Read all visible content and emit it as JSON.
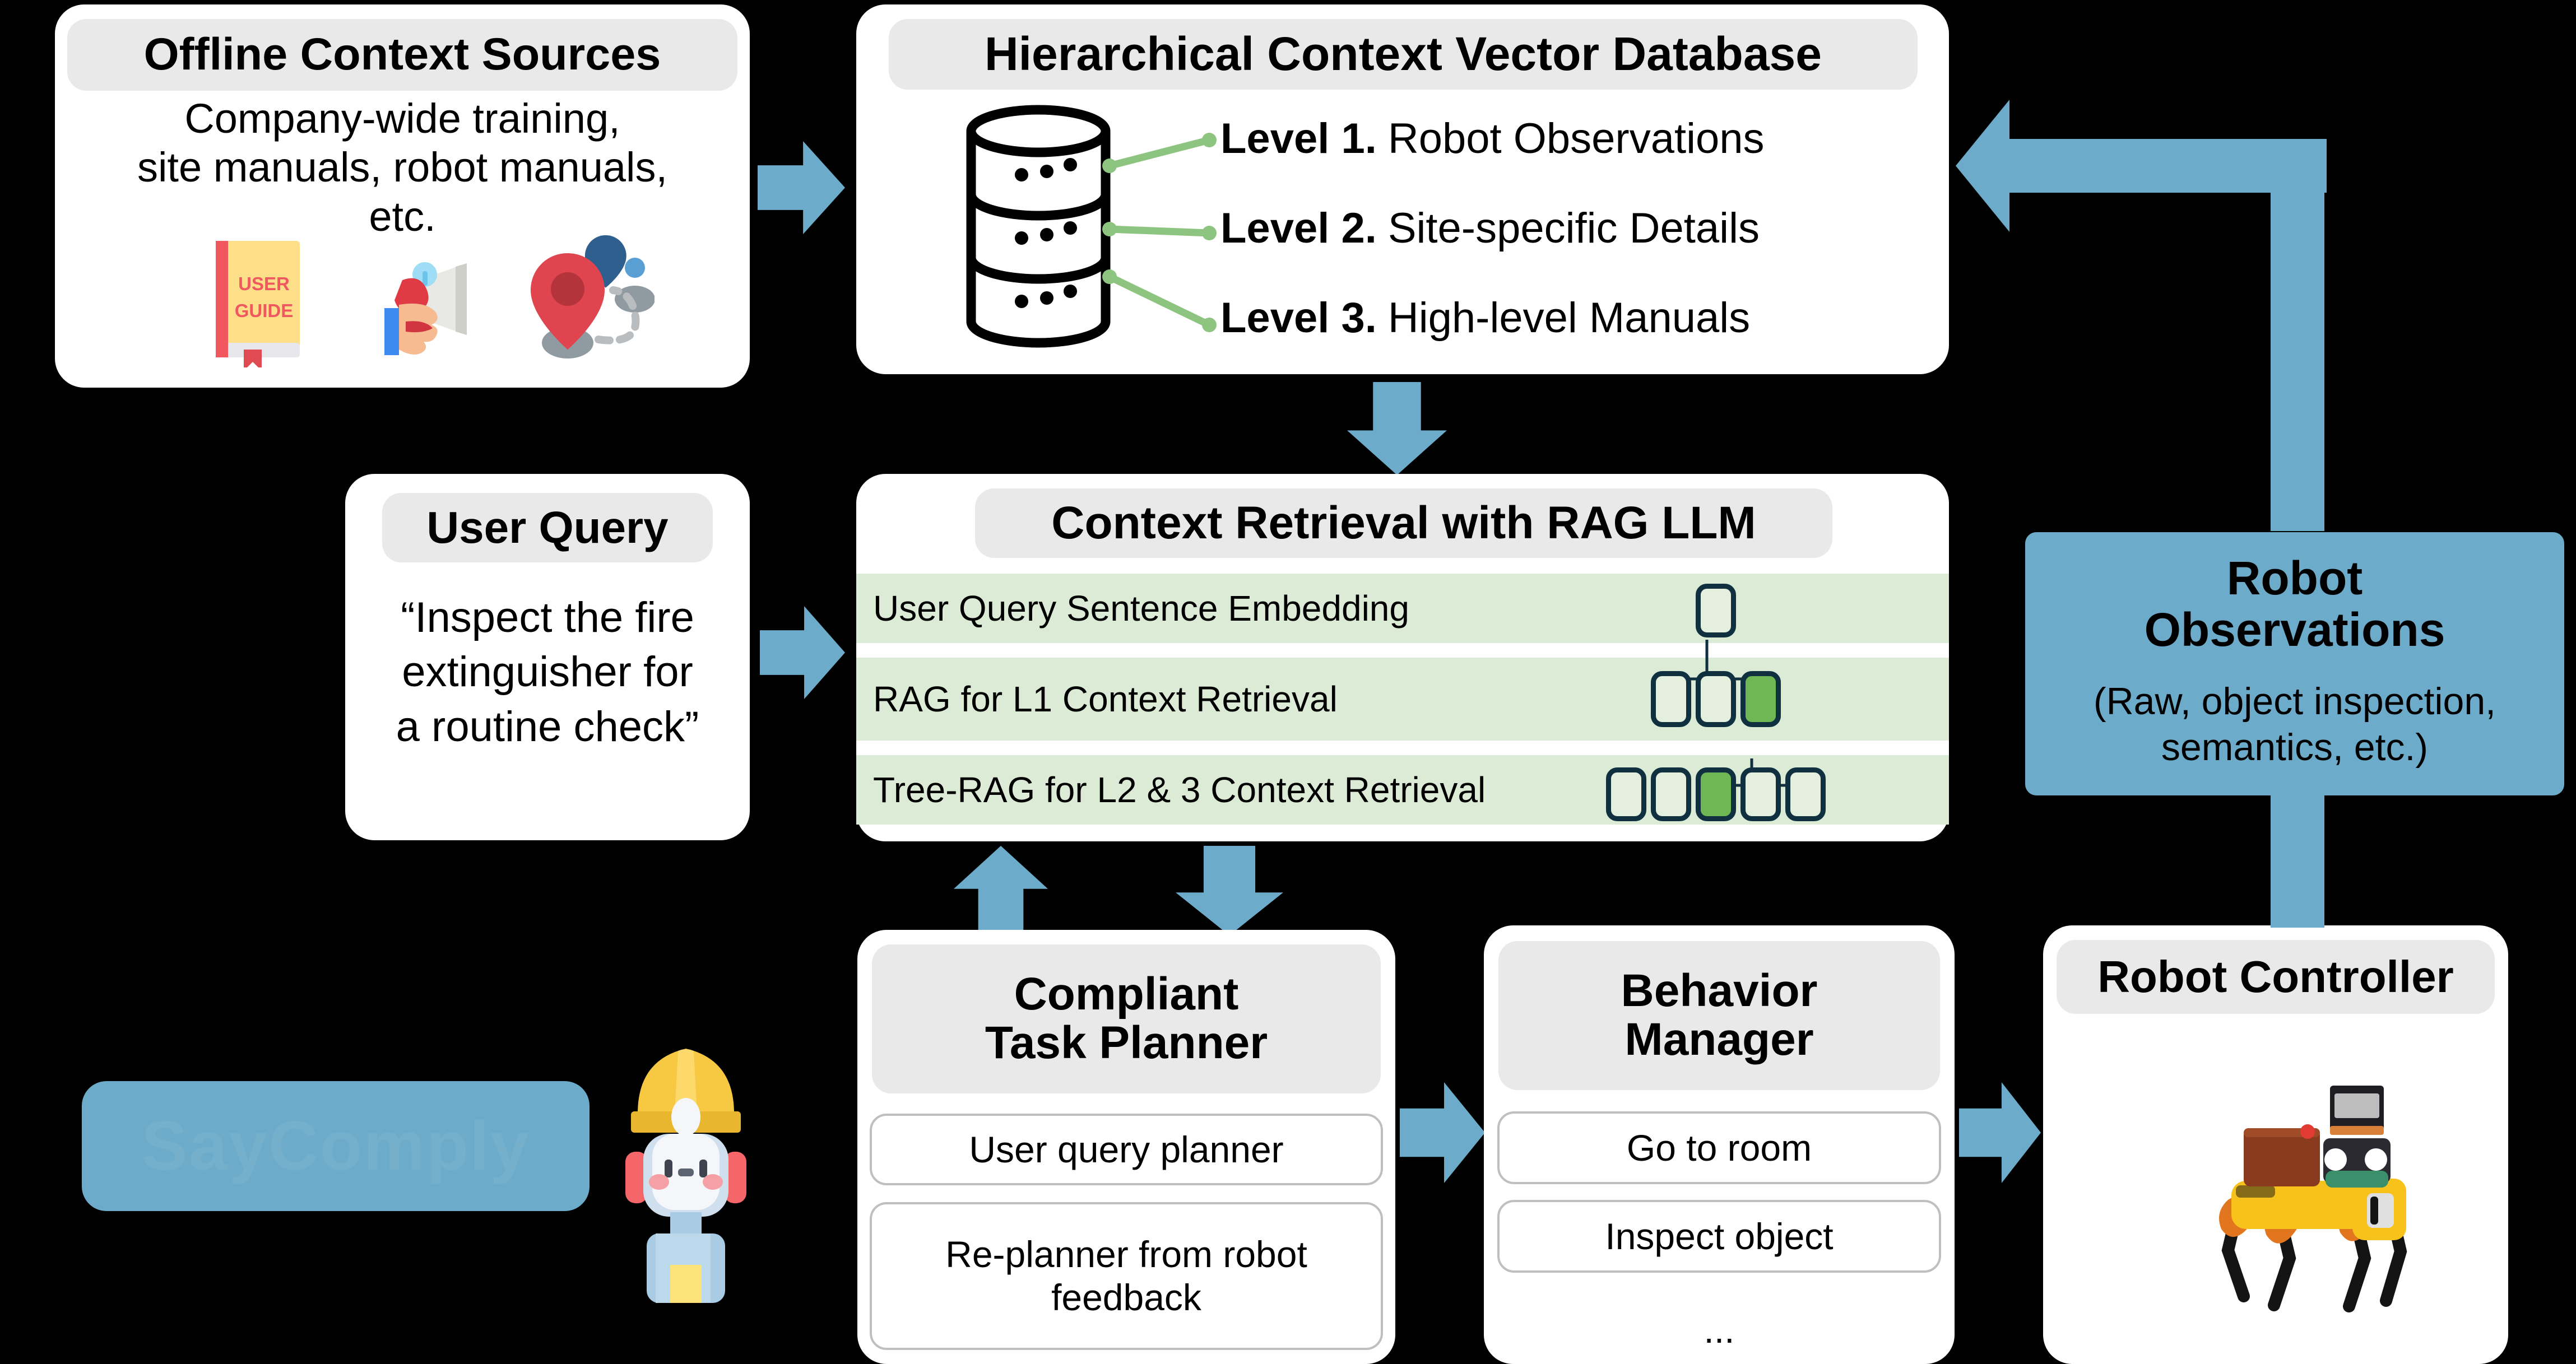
{
  "colors": {
    "arrow_blue": "#6cabc9",
    "panel_title_grey": "#e9e9e9",
    "row_green": "#dcebd5",
    "node_green": "#6fb754",
    "node_border": "#11303f",
    "leader_green": "#8dc47f",
    "background": "#000000"
  },
  "offline_sources": {
    "title": "Offline Context Sources",
    "body_line1": "Company-wide training,",
    "body_line2": "site manuals, robot manuals,",
    "body_line3": "etc.",
    "icons": [
      "user-guide-book-icon",
      "megaphone-announcement-icon",
      "map-route-pins-icon"
    ],
    "book_label_line1": "USER",
    "book_label_line2": "GUIDE"
  },
  "vector_db": {
    "title": "Hierarchical Context Vector Database",
    "icon": "database-cylinder-icon",
    "levels": [
      {
        "label": "Level 1.",
        "text": "Robot Observations"
      },
      {
        "label": "Level 2.",
        "text": "Site-specific Details"
      },
      {
        "label": "Level 3.",
        "text": "High-level Manuals"
      }
    ]
  },
  "user_query": {
    "title": "User Query",
    "line1": "“Inspect the fire",
    "line2": "extinguisher for",
    "line3": "a routine check”"
  },
  "context_retrieval": {
    "title": "Context Retrieval with RAG LLM",
    "rows": [
      {
        "label": "User Query Sentence Embedding",
        "nodes": 1,
        "highlight": -1
      },
      {
        "label": "RAG for L1 Context Retrieval",
        "nodes": 3,
        "highlight": 2
      },
      {
        "label": "Tree-RAG for L2 & 3 Context Retrieval",
        "nodes": 5,
        "highlight": 2
      }
    ]
  },
  "task_planner": {
    "title_line1": "Compliant",
    "title_line2": "Task Planner",
    "items": [
      {
        "text": "User query planner"
      },
      {
        "text": "Re-planner from robot feedback"
      }
    ]
  },
  "behavior_manager": {
    "title_line1": "Behavior",
    "title_line2": "Manager",
    "items": [
      {
        "text": "Go to room"
      },
      {
        "text": "Inspect object"
      }
    ],
    "ellipsis": "..."
  },
  "robot_controller": {
    "title": "Robot Controller",
    "icon": "quadruped-robot-icon"
  },
  "robot_observations": {
    "title_line1": "Robot",
    "title_line2": "Observations",
    "sub_line1": "(Raw, object inspection,",
    "sub_line2": "semantics, etc.)"
  },
  "branding": {
    "wordmark": "SayComply",
    "mascot": "robot-worker-mascot-icon"
  },
  "arrows": [
    {
      "name": "arrow-sources-to-db",
      "direction": "right"
    },
    {
      "name": "arrow-db-to-retrieval",
      "direction": "down"
    },
    {
      "name": "arrow-query-to-retrieval",
      "direction": "right"
    },
    {
      "name": "arrow-planner-to-retrieval",
      "direction": "up"
    },
    {
      "name": "arrow-retrieval-to-planner",
      "direction": "down"
    },
    {
      "name": "arrow-planner-to-behavior",
      "direction": "right"
    },
    {
      "name": "arrow-behavior-to-controller",
      "direction": "right"
    },
    {
      "name": "arrow-observations-to-db",
      "direction": "left"
    }
  ]
}
